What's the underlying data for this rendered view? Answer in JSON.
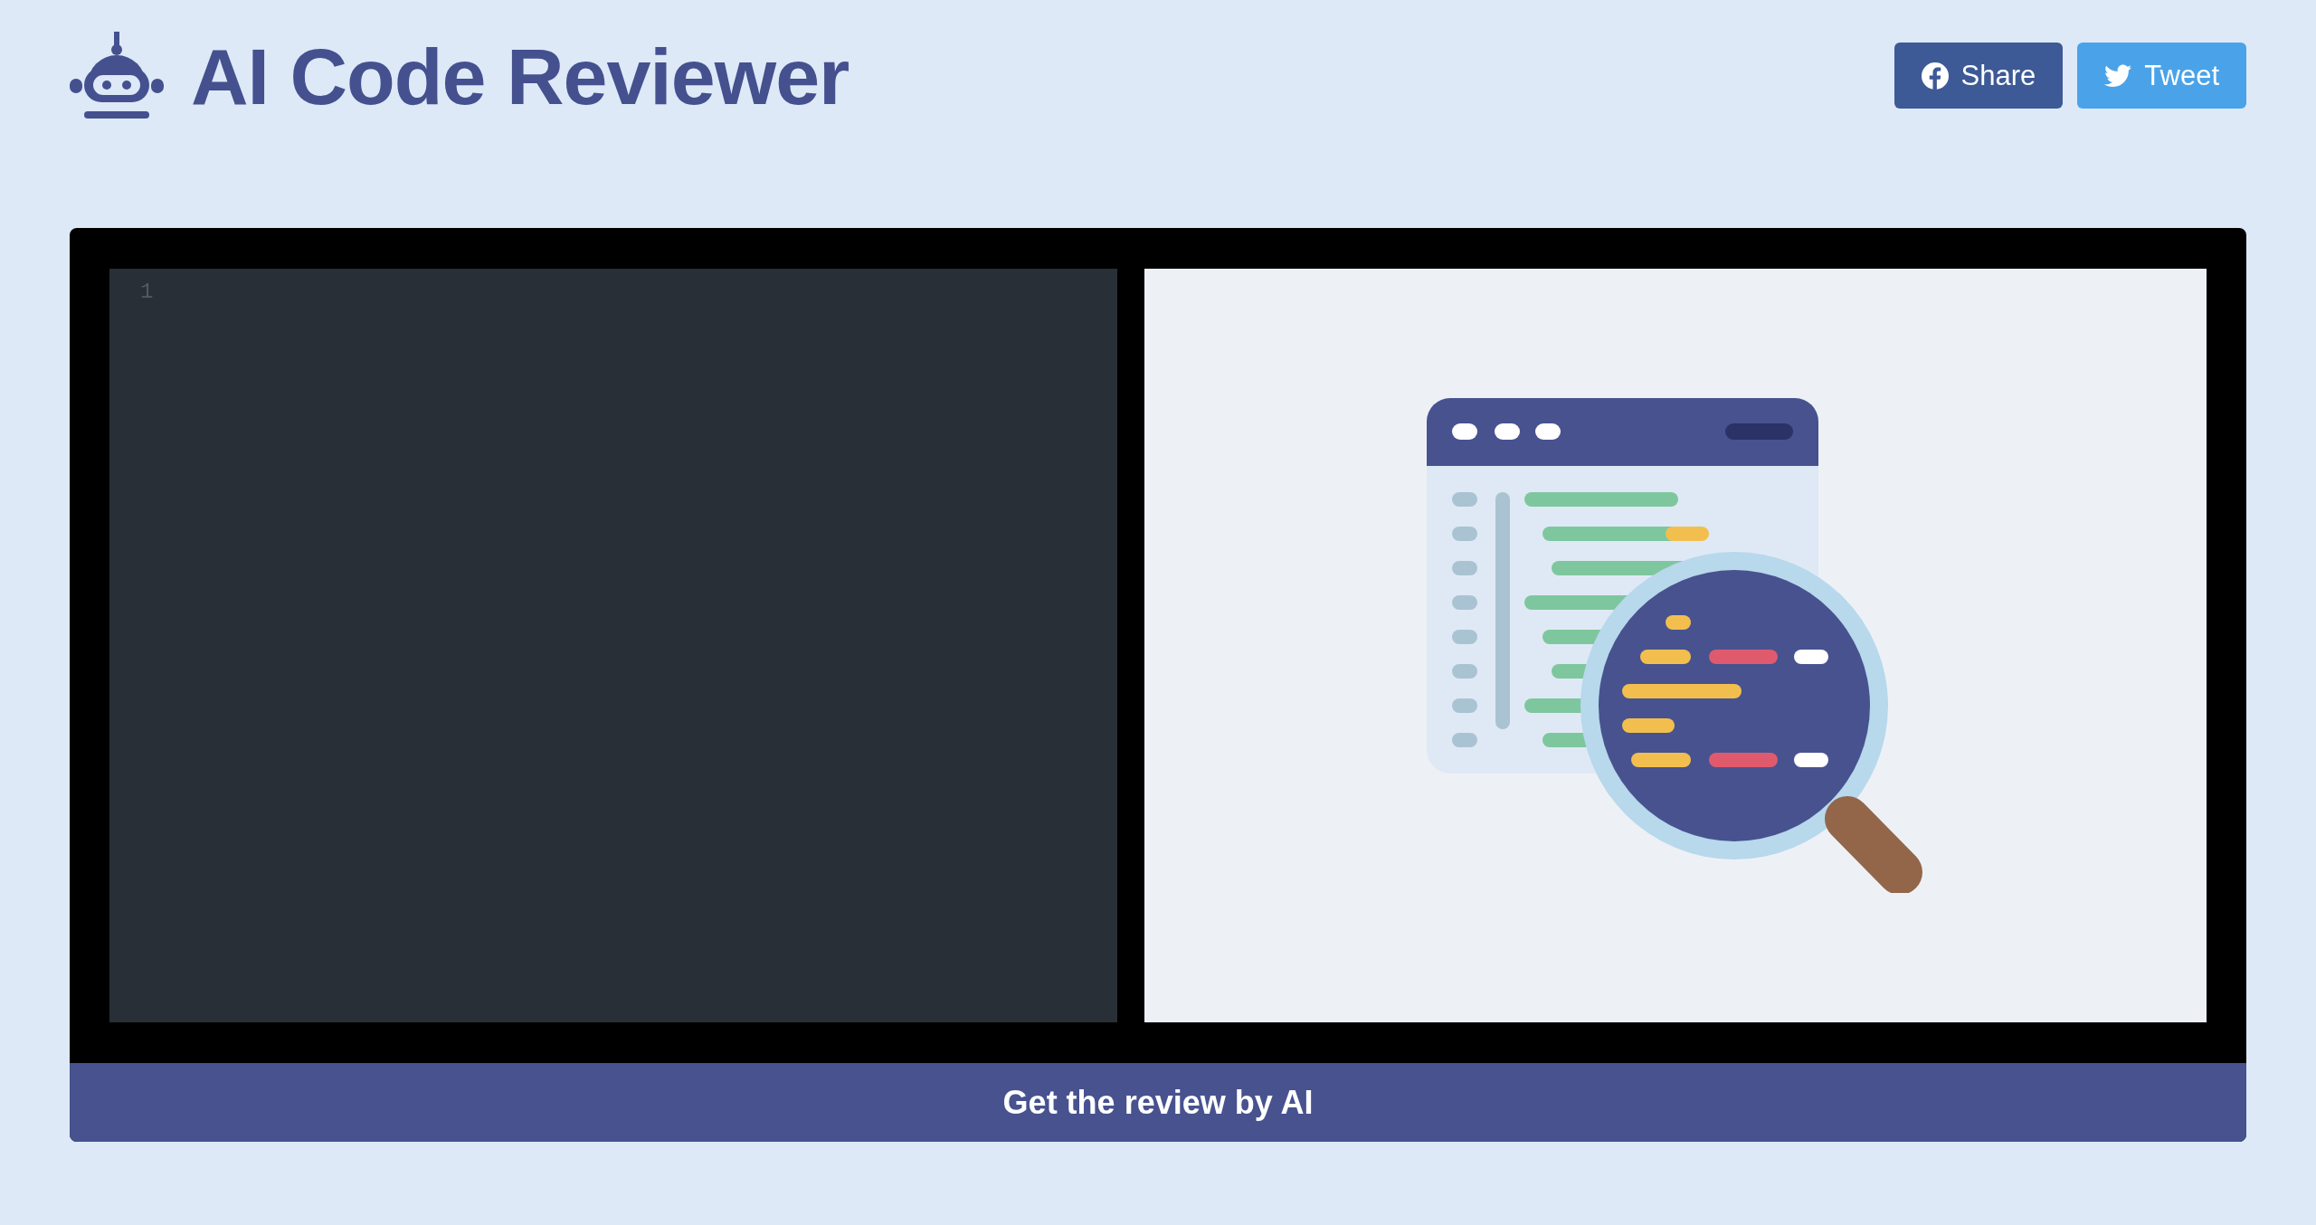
{
  "header": {
    "title": "AI Code Reviewer"
  },
  "share_buttons": [
    {
      "kind": "facebook",
      "label": "Share"
    },
    {
      "kind": "twitter",
      "label": "Tweet"
    }
  ],
  "editor": {
    "line_numbers": [
      "1"
    ]
  },
  "review_button": {
    "label": "Get the review by AI"
  }
}
